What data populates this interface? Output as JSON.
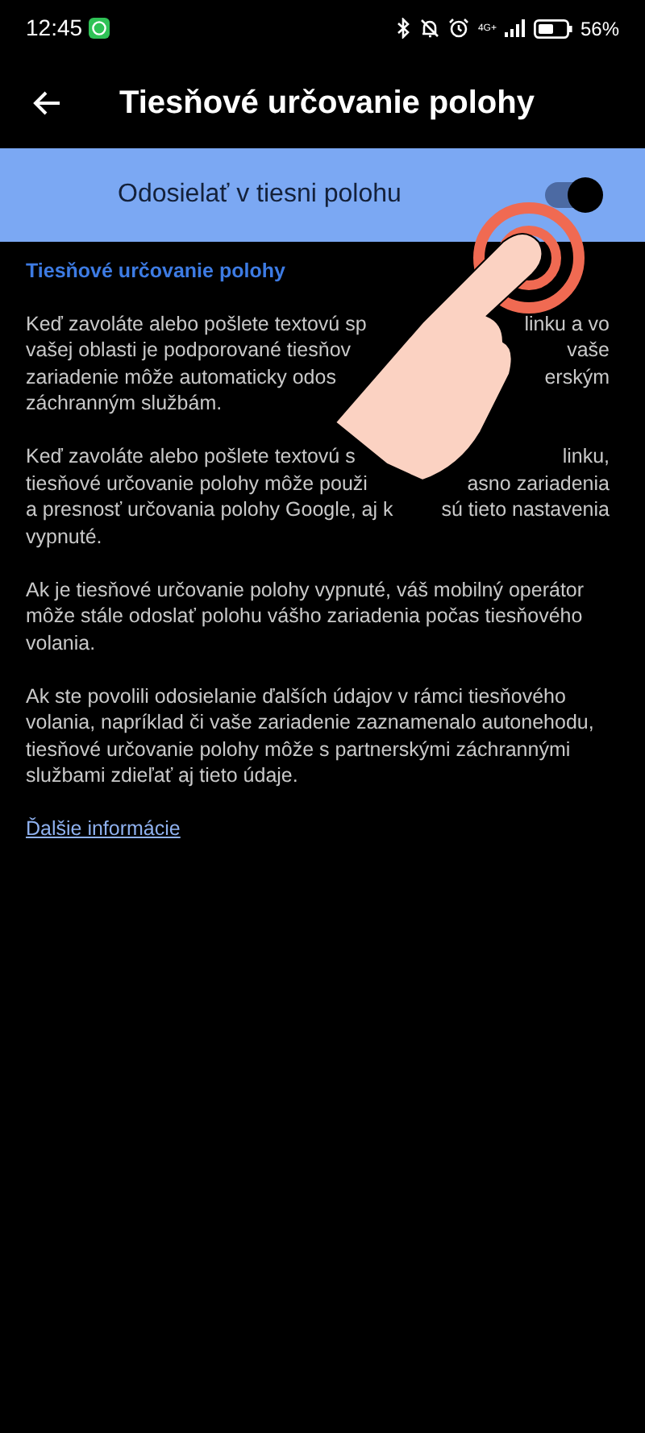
{
  "status_bar": {
    "time": "12:45",
    "network": "4G+",
    "battery": "56%"
  },
  "header": {
    "title": "Tiesňové určovanie polohy"
  },
  "main_switch": {
    "label": "Odosielať v tiesni polohu",
    "on": true
  },
  "section_title": "Tiesňové určovanie polohy",
  "paragraphs": [
    {
      "lines": [
        {
          "left": "Keď zavoláte alebo pošlete textovú sp",
          "right": "linku a vo"
        },
        {
          "left": "vašej oblasti je podporované tiesňov",
          "right": "vaše"
        },
        {
          "left": "zariadenie môže automaticky odos",
          "right": "erským"
        },
        {
          "left": "záchranným službám."
        }
      ]
    },
    {
      "lines": [
        {
          "left": "Keď zavoláte alebo pošlete textovú s",
          "right": "linku,"
        },
        {
          "left": "tiesňové určovanie polohy môže použi",
          "right": "asno zariadenia"
        },
        {
          "left": "a presnosť určovania polohy Google, aj k",
          "right": "sú tieto nastavenia"
        },
        {
          "left": "vypnuté."
        }
      ]
    },
    {
      "text": "Ak je tiesňové určovanie polohy vypnuté, váš mobilný operátor môže stále odoslať polohu vášho zariadenia počas tiesňového volania."
    },
    {
      "text": "Ak ste povolili odosielanie ďalších údajov v rámci tiesňového volania, napríklad či vaše zariadenie zaznamenalo autonehodu, tiesňové určovanie polohy môže s partnerskými záchrannými službami zdieľať aj tieto údaje."
    }
  ],
  "link": "Ďalšie informácie"
}
